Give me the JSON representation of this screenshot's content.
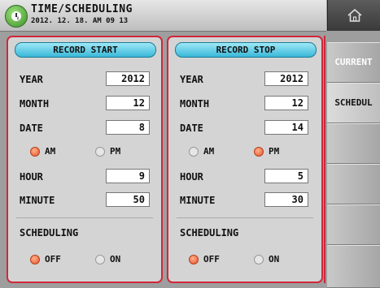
{
  "header": {
    "title": "TIME/SCHEDULING",
    "datetime": "2012. 12. 18.  AM 09 13"
  },
  "record_start": {
    "title": "RECORD START",
    "year_label": "YEAR",
    "year": "2012",
    "month_label": "MONTH",
    "month": "12",
    "date_label": "DATE",
    "date": "8",
    "am_label": "AM",
    "pm_label": "PM",
    "period_selected": "AM",
    "hour_label": "HOUR",
    "hour": "9",
    "minute_label": "MINUTE",
    "minute": "50",
    "scheduling_label": "SCHEDULING",
    "off_label": "OFF",
    "on_label": "ON",
    "scheduling_selected": "OFF"
  },
  "record_stop": {
    "title": "RECORD STOP",
    "year_label": "YEAR",
    "year": "2012",
    "month_label": "MONTH",
    "month": "12",
    "date_label": "DATE",
    "date": "14",
    "am_label": "AM",
    "pm_label": "PM",
    "period_selected": "PM",
    "hour_label": "HOUR",
    "hour": "5",
    "minute_label": "MINUTE",
    "minute": "30",
    "scheduling_label": "SCHEDULING",
    "off_label": "OFF",
    "on_label": "ON",
    "scheduling_selected": "OFF"
  },
  "tabs": [
    {
      "label": "CURRENT",
      "active": false
    },
    {
      "label": "SCHEDUL",
      "active": true
    },
    {
      "label": "",
      "active": false
    },
    {
      "label": "",
      "active": false
    },
    {
      "label": "",
      "active": false
    }
  ],
  "colors": {
    "accent": "#d0283a",
    "panel_header": "#39b8d8",
    "radio_selected": "#e8542c"
  },
  "icons": {
    "clock": "clock-icon",
    "home": "home-icon"
  }
}
